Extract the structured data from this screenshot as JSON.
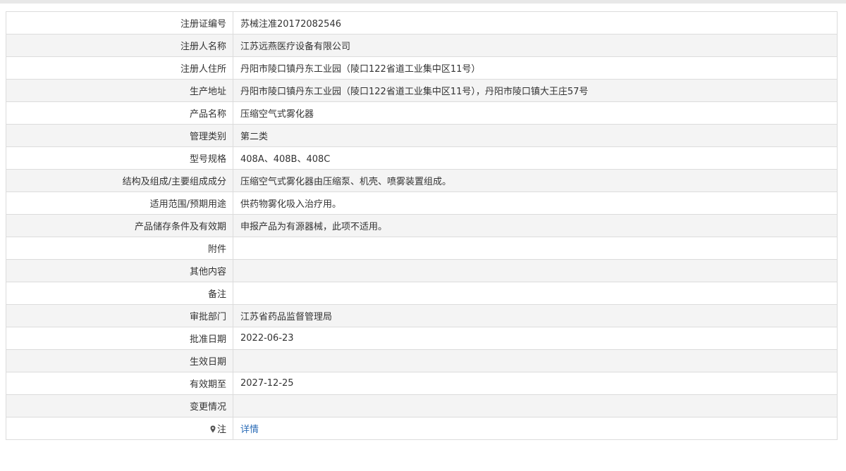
{
  "rows": [
    {
      "label": "注册证编号",
      "value": "苏械注准20172082546"
    },
    {
      "label": "注册人名称",
      "value": "江苏远燕医疗设备有限公司"
    },
    {
      "label": "注册人住所",
      "value": "丹阳市陵口镇丹东工业园（陵口122省道工业集中区11号）"
    },
    {
      "label": "生产地址",
      "value": "丹阳市陵口镇丹东工业园（陵口122省道工业集中区11号），丹阳市陵口镇大王庄57号"
    },
    {
      "label": "产品名称",
      "value": "压缩空气式雾化器"
    },
    {
      "label": "管理类别",
      "value": "第二类"
    },
    {
      "label": "型号规格",
      "value": "408A、408B、408C"
    },
    {
      "label": "结构及组成/主要组成成分",
      "value": "压缩空气式雾化器由压缩泵、机壳、喷雾装置组成。"
    },
    {
      "label": "适用范围/预期用途",
      "value": "供药物雾化吸入治疗用。"
    },
    {
      "label": "产品储存条件及有效期",
      "value": "申报产品为有源器械，此项不适用。"
    },
    {
      "label": "附件",
      "value": ""
    },
    {
      "label": "其他内容",
      "value": ""
    },
    {
      "label": "备注",
      "value": ""
    },
    {
      "label": "审批部门",
      "value": "江苏省药品监督管理局"
    },
    {
      "label": "批准日期",
      "value": "2022-06-23"
    },
    {
      "label": "生效日期",
      "value": ""
    },
    {
      "label": "有效期至",
      "value": "2027-12-25"
    },
    {
      "label": "变更情况",
      "value": ""
    }
  ],
  "note_row": {
    "label": "注",
    "icon": "location-pin-icon",
    "link_text": "详情"
  },
  "colors": {
    "link": "#2b6cb7",
    "border": "#dcdcdc",
    "stripe": "#f4f4f4"
  }
}
